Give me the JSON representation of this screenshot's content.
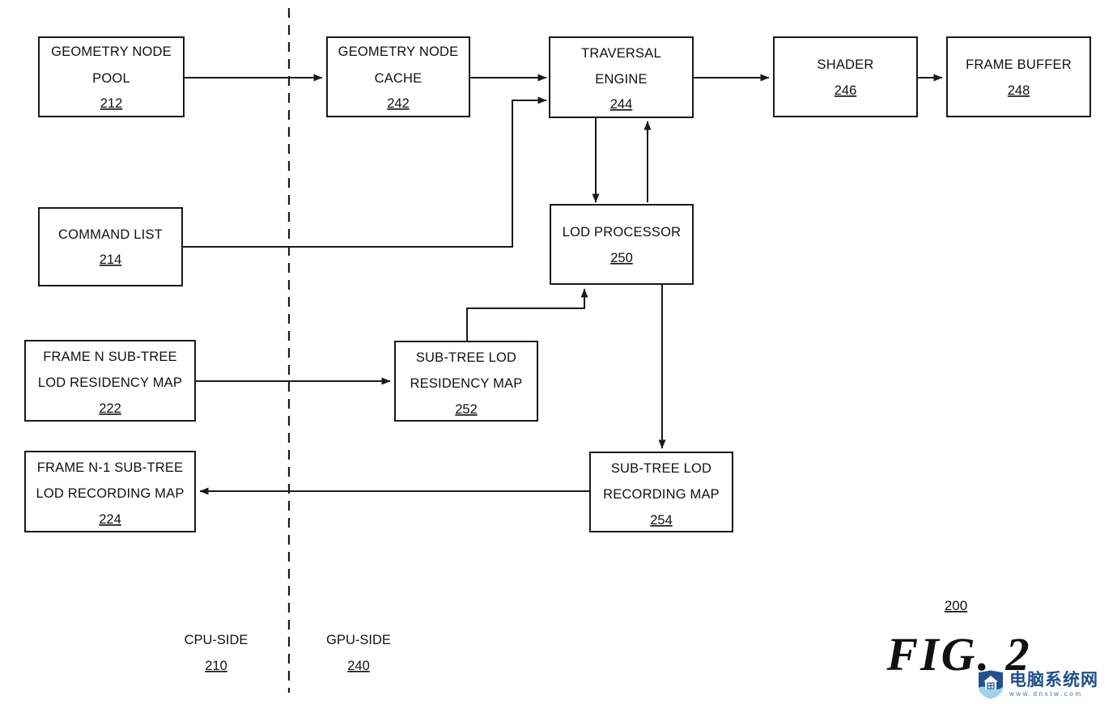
{
  "figure": {
    "caption": "FIG. 2",
    "reference_numeral": "200"
  },
  "partitions": [
    {
      "id": "cpu",
      "label": "CPU-SIDE",
      "ref": "210"
    },
    {
      "id": "gpu",
      "label": "GPU-SIDE",
      "ref": "240"
    }
  ],
  "blocks": [
    {
      "id": "geometry-node-pool",
      "lines": [
        "GEOMETRY NODE",
        "POOL"
      ],
      "ref": "212"
    },
    {
      "id": "geometry-node-cache",
      "lines": [
        "GEOMETRY NODE",
        "CACHE"
      ],
      "ref": "242"
    },
    {
      "id": "traversal-engine",
      "lines": [
        "TRAVERSAL",
        "ENGINE"
      ],
      "ref": "244"
    },
    {
      "id": "shader",
      "lines": [
        "SHADER"
      ],
      "ref": "246"
    },
    {
      "id": "frame-buffer",
      "lines": [
        "FRAME BUFFER"
      ],
      "ref": "248"
    },
    {
      "id": "command-list",
      "lines": [
        "COMMAND LIST"
      ],
      "ref": "214"
    },
    {
      "id": "lod-processor",
      "lines": [
        "LOD PROCESSOR"
      ],
      "ref": "250"
    },
    {
      "id": "frame-n-residency-map",
      "lines": [
        "FRAME N SUB-TREE",
        "LOD RESIDENCY MAP"
      ],
      "ref": "222"
    },
    {
      "id": "sub-tree-residency-map",
      "lines": [
        "SUB-TREE LOD",
        "RESIDENCY MAP"
      ],
      "ref": "252"
    },
    {
      "id": "frame-n1-recording-map",
      "lines": [
        "FRAME N-1 SUB-TREE",
        "LOD RECORDING MAP"
      ],
      "ref": "224"
    },
    {
      "id": "sub-tree-recording-map",
      "lines": [
        "SUB-TREE LOD",
        "RECORDING MAP"
      ],
      "ref": "254"
    }
  ],
  "watermark": {
    "site_name": "电脑系统网",
    "url": "www.dnxtw.com"
  },
  "colors": {
    "ink": "#1a1a1a",
    "paper": "#ffffff",
    "watermark_blue": "#1c4e8c"
  }
}
